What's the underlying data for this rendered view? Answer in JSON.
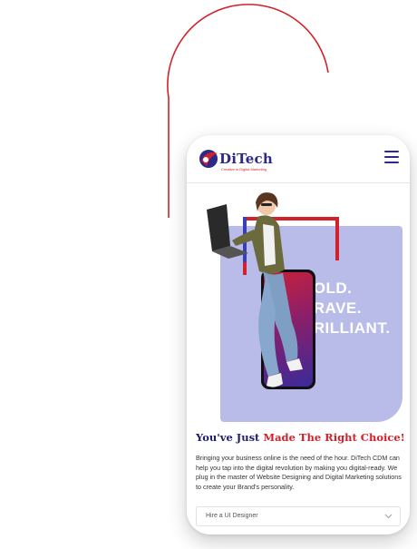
{
  "brand": {
    "name": "DiTech",
    "tagline": "Creative in Digital Marketing",
    "primary_color": "#2b2a88",
    "accent_color": "#d4202a"
  },
  "header": {
    "menu_icon": "hamburger-icon"
  },
  "hero": {
    "lines": [
      "BOLD.",
      "BRAVE.",
      "BRILLIANT."
    ]
  },
  "content": {
    "headline_part1": "You've Just",
    "headline_part2": "Made The Right Choice!",
    "body": "Bringing your business online is the need of the hour. DiTech CDM can help you tap into the digital revolution by making you digital-ready. We plug in the master of Website Designing and Digital Marketing solutions to create your Brand's personality."
  },
  "form": {
    "select_value": "Hire a UI Designer",
    "chevron_icon": "chevron-down-icon"
  }
}
